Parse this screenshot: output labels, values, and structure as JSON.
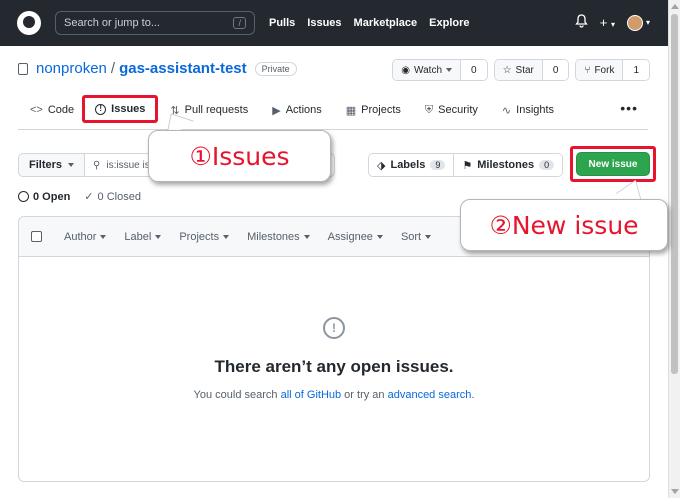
{
  "header": {
    "search_placeholder": "Search or jump to...",
    "search_shortcut": "/",
    "nav": [
      "Pulls",
      "Issues",
      "Marketplace",
      "Explore"
    ],
    "plus": "+",
    "bell": "🔔"
  },
  "repo": {
    "owner": "nonproken",
    "separator": "/",
    "name": "gas-assistant-test",
    "visibility": "Private",
    "watch_label": "Watch",
    "watch_count": "0",
    "star_label": "Star",
    "star_count": "0",
    "fork_label": "Fork",
    "fork_count": "1"
  },
  "tabs": [
    {
      "label": "Code",
      "icon": "<>"
    },
    {
      "label": "Issues",
      "icon": "!"
    },
    {
      "label": "Pull requests",
      "icon": "⇅"
    },
    {
      "label": "Actions",
      "icon": "▶"
    },
    {
      "label": "Projects",
      "icon": "▦"
    },
    {
      "label": "Security",
      "icon": "⛨"
    },
    {
      "label": "Insights",
      "icon": "∿"
    }
  ],
  "tab_more": "•••",
  "filters": {
    "button": "Filters",
    "query": "is:issue is:open"
  },
  "labels": {
    "label": "Labels",
    "count": "9"
  },
  "milestones": {
    "label": "Milestones",
    "count": "0"
  },
  "new_issue": "New issue",
  "states": {
    "open": "0 Open",
    "closed": "0 Closed"
  },
  "list_header": [
    "Author",
    "Label",
    "Projects",
    "Milestones",
    "Assignee",
    "Sort"
  ],
  "empty": {
    "icon": "!",
    "title": "There aren’t any open issues.",
    "sub_prefix": "You could search ",
    "link1": "all of GitHub",
    "sub_middle": " or try an ",
    "link2": "advanced search",
    "sub_suffix": "."
  },
  "callouts": {
    "issues": "①Issues",
    "new_issue": "②New issue"
  },
  "colors": {
    "header_bg": "#24292f",
    "link": "#0969da",
    "green": "#2da44e",
    "highlight": "#e8132d"
  }
}
